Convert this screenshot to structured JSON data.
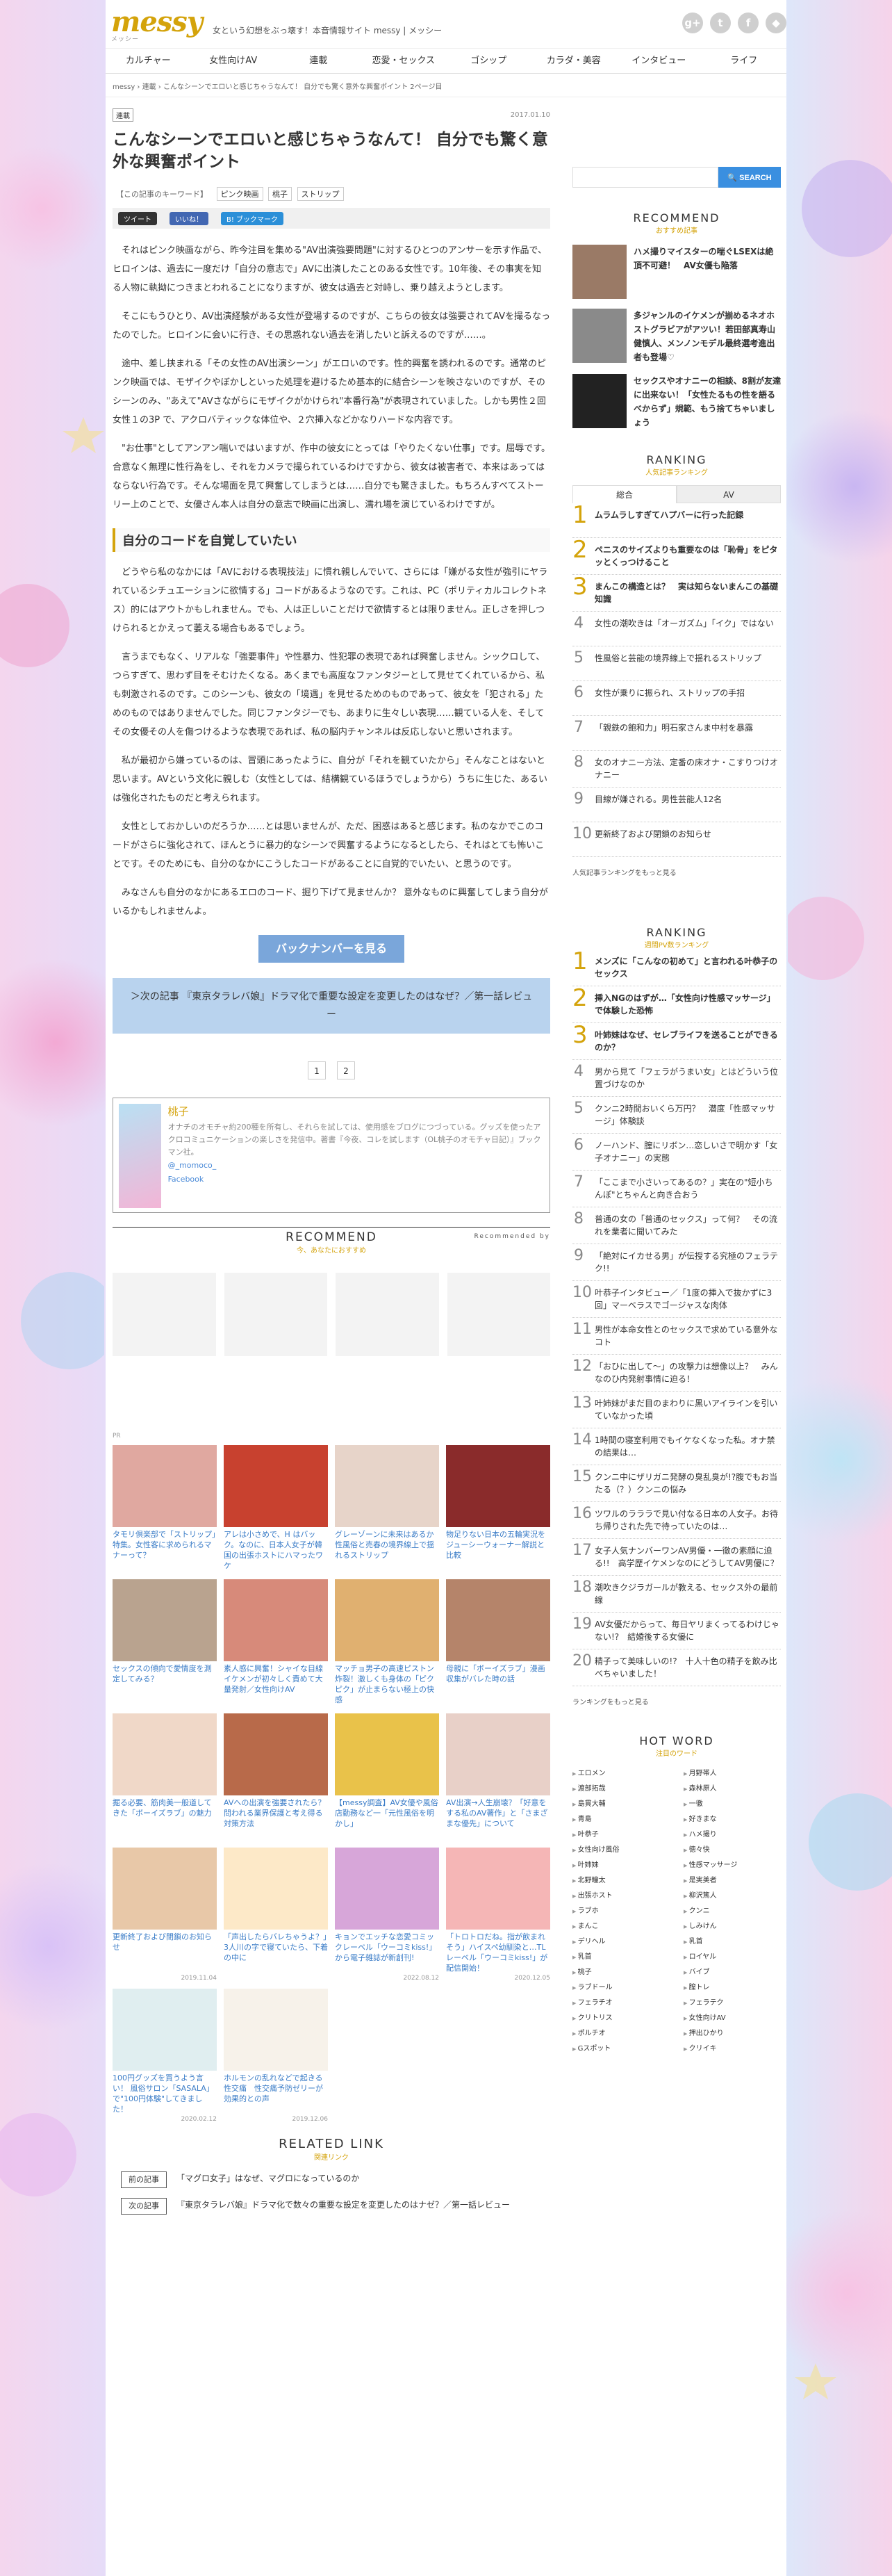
{
  "site": {
    "logo": "messy",
    "logo_sub": "メッシー",
    "tagline": "女という幻想をぶっ壊す！本音情報サイト messy | メッシー"
  },
  "nav": [
    "カルチャー",
    "女性向けAV",
    "連載",
    "恋愛・セックス",
    "ゴシップ",
    "カラダ・美容",
    "インタビュー",
    "ライフ"
  ],
  "breadcrumb": "messy › 連載 › こんなシーンでエロいと感じちゃうなんて！ 自分でも驚く意外な興奮ポイント 2ページ目",
  "article": {
    "category": "連載",
    "date": "2017.01.10",
    "title": "こんなシーンでエロいと感じちゃうなんて！ 自分でも驚く意外な興奮ポイント",
    "keywords_label": "【この記事のキーワード】",
    "keywords": [
      "ピンク映画",
      "桃子",
      "ストリップ"
    ],
    "share": [
      "ツイート",
      "いいね！",
      "B! ブックマーク"
    ],
    "paragraphs": [
      "それはピンク映画ながら、昨今注目を集める\"AV出演強要問題\"に対するひとつのアンサーを示す作品で、ヒロインは、過去に一度だけ「自分の意志で」AVに出演したことのある女性です。10年後、その事実を知る人物に執拗につきまとわれることになりますが、彼女は過去と対峙し、乗り越えようとします。",
      "そこにもうひとり、AV出演経験がある女性が登場するのですが、こちらの彼女は強要されてAVを撮るなったのでした。ヒロインに会いに行き、その思惑れない過去を消したいと訴えるのですが……。",
      "途中、差し挟まれる「その女性のAV出演シーン」がエロいのです。性的興奮を誘われるのです。通常のピンク映画では、モザイクやぼかしといった処理を避けるため基本的に結合シーンを映さないのですが、そのシーンのみ、\"あえて\"AVさながらにモザイクがかけられ\"本番行為\"が表現されていました。しかも男性２回女性１の3P で、アクロバティックな体位や、２穴挿入などかなりハードな内容です。",
      "\"お仕事\"としてアンアン喘いではいますが、作中の彼女にとっては「やりたくない仕事」です。屈辱です。合意なく無理に性行為をし、それをカメラで撮られているわけですから、彼女は被害者で、本来はあってはならない行為です。そんな場面を見て興奮してしまうとは……自分でも驚きました。もちろんすべてストーリー上のことで、女優さん本人は自分の意志で映画に出演し、濡れ場を演じているわけですが。",
      "どうやら私のなかには「AVにおける表現技法」に慣れ親しんでいて、さらには「嫌がる女性が強引にヤラれているシチュエーションに欲情する」コードがあるようなのです。これは、PC（ポリティカルコレクトネス）的にはアウトかもしれません。でも、人は正しいことだけで欲情するとは限りません。正しさを押しつけられるとかえって萎える場合もあるでしょう。",
      "言うまでもなく、リアルな「強要事件」や性暴力、性犯罪の表現であれば興奮しません。シックロして、つらすぎて、思わず目をそむけたくなる。あくまでも高度なファンタジーとして見せてくれているから、私も刺激されるのです。このシーンも、彼女の「境遇」を見せるためのものであって、彼女を「犯される」ためのものではありませんでした。同じファンタジーでも、あまりに生々しい表現……観ている人を、そしてその女優その人を傷つけるような表現であれば、私の脳内チャンネルは反応しないと思いされます。",
      "私が最初から嫌っているのは、冒頭にあったように、自分が「それを観ていたから」そんなことはないと思います。AVという文化に親しむ（女性としては、結構観ているほうでしょうから）うちに生じた、あるいは強化されたものだと考えられます。",
      "女性としておかしいのだろうか……とは思いませんが、ただ、困惑はあると感じます。私のなかでこのコードがさらに強化されて、ほんとうに暴力的なシーンで興奮するようになるとしたら、それはとても怖いことです。そのためにも、自分のなかにこうしたコードがあることに自覚的でいたい、と思うのです。",
      "みなさんも自分のなかにあるエロのコード、掘り下げて見ませんか？ 意外なものに興奮してしまう自分がいるかもしれませんよ。"
    ],
    "h2": "自分のコードを自覚していたい",
    "back_number": "バックナンバーを見る",
    "next": "＞次の記事 『東京タラレバ娘』ドラマ化で重要な設定を変更したのはなぜ？／第一話レビュー",
    "pages": [
      "1",
      "2"
    ]
  },
  "author": {
    "name": "桃子",
    "bio": "オナチのオモチャ約200種を所有し、それらを試しては、使用感をブログにつづっている。グッズを使ったアクロコミュニケーションの楽しさを発信中。著書『今夜、コレを試します（OL桃子のオモチャ日記）』ブックマン社。",
    "twitter": "@_momoco_",
    "facebook": "Facebook"
  },
  "recommend": {
    "title": "RECOMMEND",
    "sub": "今、あなたにおすすめ",
    "by": "Recommended by",
    "pr": "PR"
  },
  "cards": [
    {
      "t": "タモリ倶楽部で「ストリップ」特集。女性客に求められるマナーって？",
      "d": ""
    },
    {
      "t": "アレは小さめで、H はバック。なのに、日本人女子が韓国の出張ホストにハマったワケ",
      "d": ""
    },
    {
      "t": "グレーゾーンに未来はあるか　性風俗と売春の境界線上で揺れるストリップ",
      "d": ""
    },
    {
      "t": "物足りない日本の五輪実況をジューシーウォーナー解説と比較",
      "d": ""
    },
    {
      "t": "セックスの傾向で愛情度を測定してみる？",
      "d": ""
    },
    {
      "t": "素人感に興奮！シャイな目線イケメンが初々しく責めて大量発射／女性向けAV",
      "d": ""
    },
    {
      "t": "マッチョ男子の高速ピストン炸裂！激しくも身体の「ピクピク」が止まらない極上の快感",
      "d": ""
    },
    {
      "t": "母親に「ボーイズラブ」漫画収集がバレた時の話",
      "d": ""
    },
    {
      "t": "掘る必要、筋肉美一般道してきた「ボーイズラブ」の魅力",
      "d": ""
    },
    {
      "t": "AVへの出演を強要されたら？ 問われる業界保護と考え得る対策方法",
      "d": ""
    },
    {
      "t": "【messy調査】AV女優や風俗店勤務など一「元性風俗を明かし」",
      "d": ""
    },
    {
      "t": "AV出演→人生崩壊？「好意をする私のAV著作」と「さまざまな優先」について",
      "d": ""
    },
    {
      "t": "更新終了および閉鎖のお知らせ",
      "d": "2019.11.04"
    },
    {
      "t": "「声出したらバレちゃうよ？」3人川の字で寝ていたら、下着の中に",
      "d": ""
    },
    {
      "t": "キョンでエッチな恋愛コミックレーベル「ウーコミkiss!」から電子雑誌が新創刊!",
      "d": "2022.08.12"
    },
    {
      "t": "「トロトロだね。指が飲まれそう」ハイスペ幼馴染と…TLレーベル「ウーコミkiss!」が配信開始！",
      "d": "2020.12.05"
    },
    {
      "t": "100円グッズを買うよう言い！ 風俗サロン「SASALA」で\"100円体験\"してきました！",
      "d": "2020.02.12"
    },
    {
      "t": "ホルモンの乱れなどで起きる性交痛　性交痛予防ゼリーが効果的との声",
      "d": "2019.12.06"
    }
  ],
  "related": {
    "title": "RELATED LINK",
    "sub": "関連リンク",
    "prev_label": "前の記事",
    "prev": "「マグロ女子」はなぜ、マグロになっているのか",
    "next_label": "次の記事",
    "next": "『東京タラレバ娘』ドラマ化で数々の重要な設定を変更したのはナゼ？／第一話レビュー"
  },
  "search": {
    "placeholder": "",
    "button": "SEARCH"
  },
  "side_rec": {
    "title": "RECOMMEND",
    "sub": "おすすめ記事",
    "items": [
      "ハメ撮りマイスターの喘ぐLSEXは絶頂不可避！　AV女優も陥落",
      "多ジャンルのイケメンが揃めるネオホストグラビアがアツい！若田部真寿山健慎人、メンノンモデル最終選考進出者も登場♡",
      "セックスやオナニーの相談、8割が友達に出来ない！「女性たるもの性を語るべからず」規範、もう捨てちゃいましょう"
    ]
  },
  "rank1": {
    "title": "RANKING",
    "sub": "人気記事ランキング",
    "tabs": [
      "総合",
      "AV"
    ],
    "items": [
      "ムラムラしすぎてハプバーに行った記録",
      "ペニスのサイズよりも重要なのは「恥骨」をピタッとくっつけること",
      "まんこの構造とは？　実は知らないまんこの基礎知識",
      "女性の潮吹きは「オーガズム」「イク」ではない",
      "性風俗と芸能の境界線上で揺れるストリップ",
      "女性が乗りに振られ、ストリップの手招",
      "「親鉄の飽和力」明石家さんま中村を暴露",
      "女のオナニー方法、定番の床オナ・こすりつけオナニー",
      "目線が嫌される。男性芸能人12名",
      "更新終了および閉鎖のお知らせ"
    ],
    "more": "人気記事ランキングをもっと見る"
  },
  "rank2": {
    "title": "RANKING",
    "sub": "週間PV数ランキング",
    "items": [
      "メンズに「こんなの初めて」と言われる叶恭子のセックス",
      "挿入NGのはずが…「女性向け性感マッサージ」で体験した恐怖",
      "叶姉妹はなぜ、セレブライフを送ることができるのか？",
      "男から見て「フェラがうまい女」とはどういう位置づけなのか",
      "クンニ2時間おいくら万円？　潜度「性感マッサージ」体験談",
      "ノーハンド、膣にリボン…恋しいさで明かす「女子オナニー」の実態",
      "「ここまで小さいってあるの？」実在の\"短小ちんぽ\"とちゃんと向き合おう",
      "普通の女の「普通のセックス」って何？　その流れを業者に聞いてみた",
      "「絶対にイカせる男」が伝授する究極のフェラテク!!",
      "叶恭子インタビュー／「1度の挿入で抜かずに3回」マーベラスでゴージャスな肉体",
      "男性が本命女性とのセックスで求めている意外なコト",
      "「おひに出して～」の攻撃力は想像以上？　みんなのひ内発射事情に迫る！",
      "叶姉妹がまだ目のまわりに黒いアイラインを引いていなかった頃",
      "1時間の寝室利用でもイケなくなった私。オナ禁の結果は…",
      "クンニ中にザリガニ発酵の臭乱臭が!?腹でもお当たる（？）クンニの悩み",
      "ツワルのラララで見い付なる日本の人女子。お待ち帰りされた先で待っていたのは…",
      "女子人気ナンバーワンAV男優・一徹の素顔に迫る!!　高学歴イケメンなのにどうしてAV男優に？",
      "潮吹きクジラガールが教える、セックス外の最前線",
      "AV女優だからって、毎日ヤリまくってるわけじゃない!?　結婚後する女優に",
      "精子って美味しいの!?　十人十色の精子を飲み比べちゃいました！"
    ],
    "more": "ランキングをもっと見る"
  },
  "hotword": {
    "title": "HOT WORD",
    "sub": "注目のワード",
    "items": [
      "エロメン",
      "月野帯人",
      "渡部拓哉",
      "森林原人",
      "島貫大輔",
      "一徹",
      "青島",
      "好きまな",
      "叶恭子",
      "ハメ撮り",
      "女性向け風俗",
      "徳々快",
      "叶姉妹",
      "性感マッサージ",
      "北野瞳太",
      "是実美者",
      "出張ホスト",
      "柳沢篤人",
      "ラブホ",
      "クンニ",
      "まんこ",
      "しみけん",
      "デリヘル",
      "乳首",
      "乳首",
      "ロイヤル",
      "桃子",
      "バイブ",
      "ラブドール",
      "膣トレ",
      "フェラチオ",
      "フェラテク",
      "クリトリス",
      "女性向けAV",
      "ポルチオ",
      "押出ひかり",
      "Gスポット",
      "クリイキ"
    ]
  }
}
